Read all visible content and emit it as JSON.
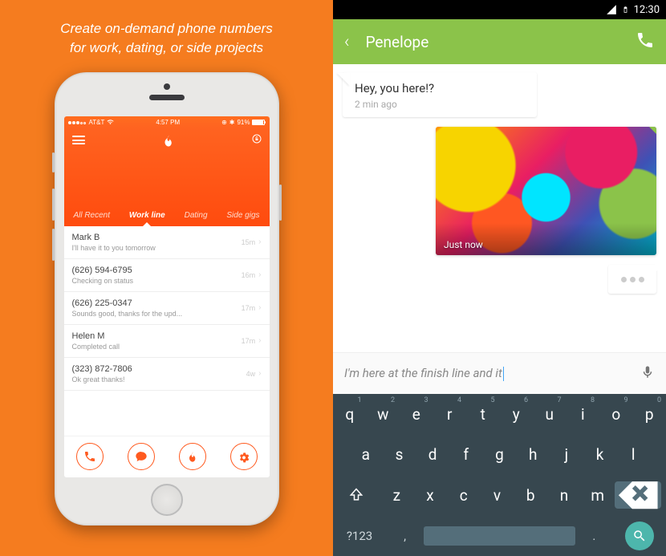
{
  "left": {
    "tagline_l1": "Create on-demand phone numbers",
    "tagline_l2": "for work, dating, or side projects",
    "status": {
      "carrier": "AT&T",
      "time": "4:57 PM",
      "battery": "91%"
    },
    "tabs": [
      "All Recent",
      "Work line",
      "Dating",
      "Side gigs"
    ],
    "active_tab": 1,
    "rows": [
      {
        "name": "Mark B",
        "preview": "I'll have it to you tomorrow",
        "time": "15m"
      },
      {
        "name": "(626) 594-6795",
        "preview": "Checking on status",
        "time": "16m"
      },
      {
        "name": "(626) 225-0347",
        "preview": "Sounds good, thanks for the upd...",
        "time": "17m"
      },
      {
        "name": "Helen M",
        "preview": "Completed call",
        "time": "17m"
      },
      {
        "name": "(323) 872-7806",
        "preview": "Ok great thanks!",
        "time": "4w"
      }
    ],
    "actions": [
      "phone",
      "chat",
      "fire",
      "gear"
    ]
  },
  "right": {
    "status_time": "12:30",
    "contact": "Penelope",
    "msg_in": {
      "text": "Hey, you here!?",
      "time": "2 min ago"
    },
    "img_time": "Just now",
    "compose_text": "I'm here at the finish line and it",
    "keyboard": {
      "row1": [
        [
          "q",
          "1"
        ],
        [
          "w",
          "2"
        ],
        [
          "e",
          "3"
        ],
        [
          "r",
          "4"
        ],
        [
          "t",
          "5"
        ],
        [
          "y",
          "6"
        ],
        [
          "u",
          "7"
        ],
        [
          "i",
          "8"
        ],
        [
          "o",
          "9"
        ],
        [
          "p",
          "0"
        ]
      ],
      "row2": [
        "a",
        "s",
        "d",
        "f",
        "g",
        "h",
        "j",
        "k",
        "l"
      ],
      "row3": [
        "z",
        "x",
        "c",
        "v",
        "b",
        "n",
        "m"
      ],
      "sym": "?123",
      "period": ".",
      "comma": ","
    }
  }
}
